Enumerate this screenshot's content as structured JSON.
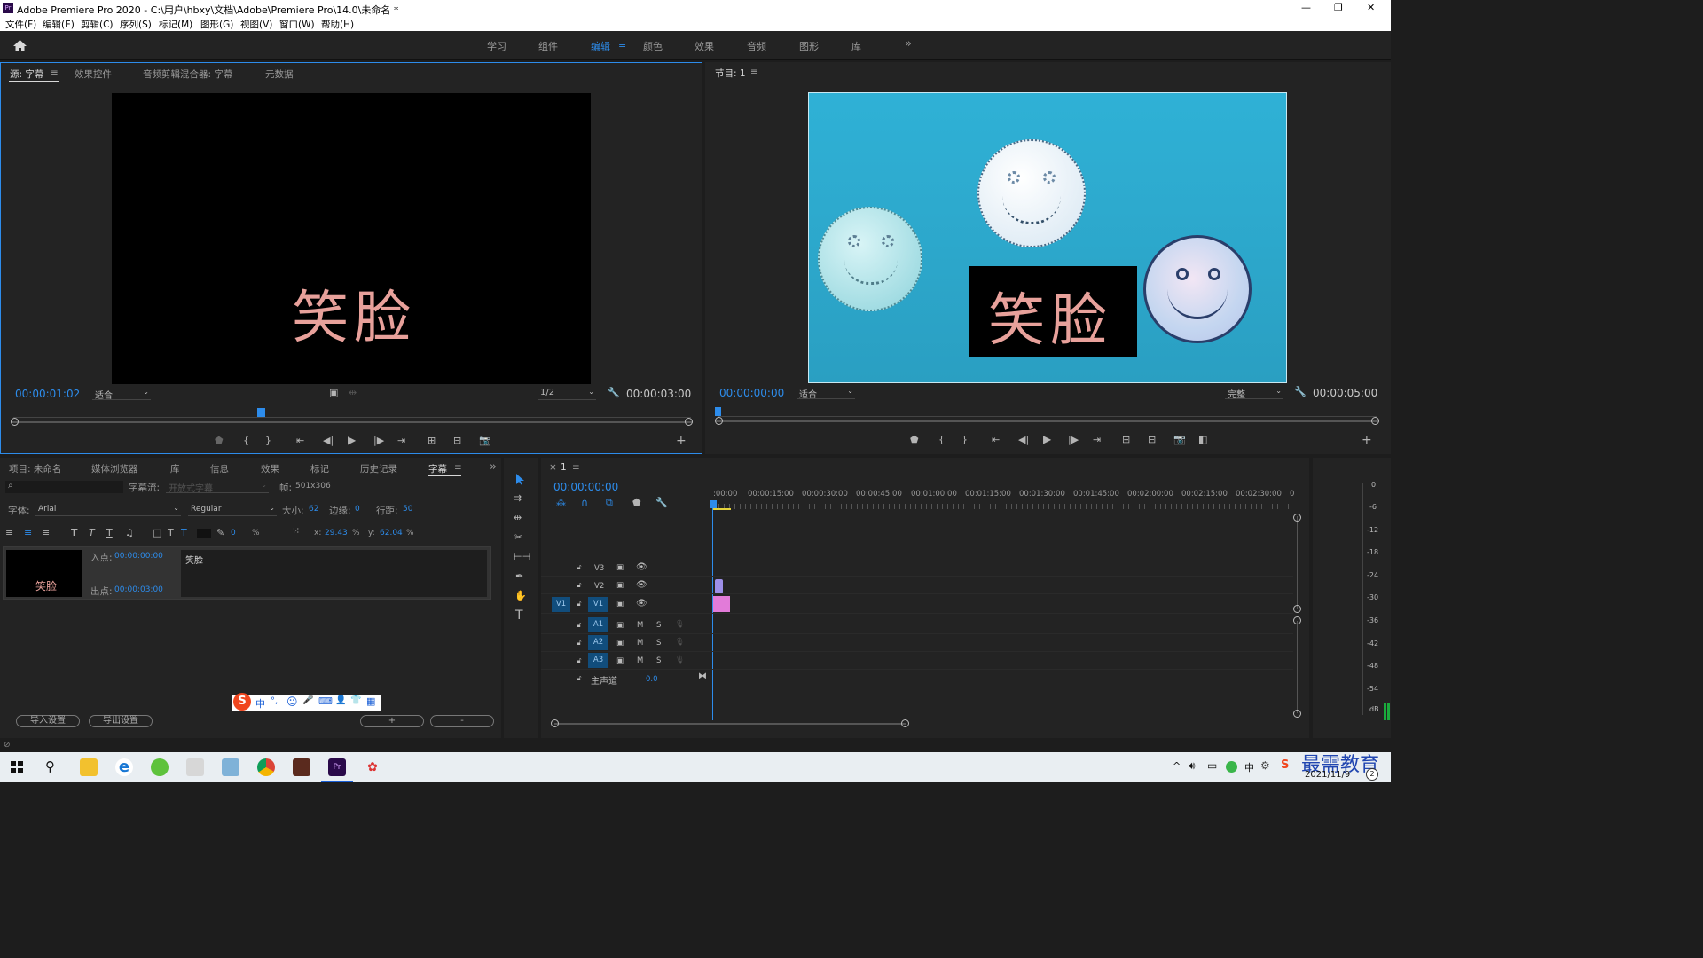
{
  "app": {
    "title": "Adobe Premiere Pro 2020 - C:\\用户\\hbxy\\文档\\Adobe\\Premiere Pro\\14.0\\未命名 *",
    "app_icon_label": "Pr"
  },
  "window_controls": {
    "minimize": "—",
    "maximize": "❐",
    "close": "✕"
  },
  "menu": [
    "文件(F)",
    "编辑(E)",
    "剪辑(C)",
    "序列(S)",
    "标记(M)",
    "图形(G)",
    "视图(V)",
    "窗口(W)",
    "帮助(H)"
  ],
  "workspaces": {
    "items": [
      "学习",
      "组件",
      "编辑",
      "颜色",
      "效果",
      "音频",
      "图形",
      "库"
    ],
    "active": "编辑",
    "more": "»"
  },
  "source_panel": {
    "tabs": [
      "源: 字幕",
      "效果控件",
      "音频剪辑混合器: 字幕",
      "元数据"
    ],
    "active_tab": "源: 字幕",
    "caption_text": "笑脸",
    "timecode": "00:00:01:02",
    "fit": "适合",
    "resolution": "1/2",
    "duration": "00:00:03:00"
  },
  "program_panel": {
    "title": "节目: 1",
    "caption_text": "笑脸",
    "timecode": "00:00:00:00",
    "fit": "适合",
    "quality": "完整",
    "duration": "00:00:05:00"
  },
  "colors": {
    "accent": "#2d8ceb",
    "program_bg": "#2fb1d6",
    "caption_pink": "#e8a19b",
    "clip_pink": "#e27bd9",
    "track_blue": "#114d7c"
  },
  "project_panel": {
    "tabs": [
      "项目: 未命名",
      "媒体浏览器",
      "库",
      "信息",
      "效果",
      "标记",
      "历史记录",
      "字幕"
    ],
    "active_tab": "字幕",
    "more": "»",
    "caption_stream_label": "字幕流:",
    "caption_stream_value": "开放式字幕",
    "frame_label": "帧:",
    "frame_value": "501x306",
    "font_label": "字体:",
    "font_value": "Arial",
    "style_value": "Regular",
    "size_label": "大小:",
    "size_value": "62",
    "edge_label": "边缘:",
    "edge_value": "0",
    "line_label": "行距:",
    "line_value": "50",
    "opacity_value": "0",
    "opacity_unit": "%",
    "x_label": "x:",
    "x_value": "29.43",
    "y_label": "y:",
    "y_value": "62.04",
    "pct": "%",
    "entry": {
      "thumb_text": "笑脸",
      "in_label": "入点:",
      "in_value": "00:00:00:00",
      "out_label": "出点:",
      "out_value": "00:00:03:00",
      "text": "笑脸"
    },
    "import_btn": "导入设置",
    "export_btn": "导出设置",
    "add_btn": "+",
    "remove_btn": "-"
  },
  "ime_toolbar": {
    "logo": "S",
    "items": [
      "中",
      "°,",
      "☺",
      "🎤",
      "⌨",
      "👤",
      "👕",
      "▦"
    ]
  },
  "timeline": {
    "sequence": "1",
    "timecode": "00:00:00:00",
    "ruler": [
      ":00:00",
      "00:00:15:00",
      "00:00:30:00",
      "00:00:45:00",
      "00:01:00:00",
      "00:01:15:00",
      "00:01:30:00",
      "00:01:45:00",
      "00:02:00:00",
      "00:02:15:00",
      "00:02:30:00",
      "0"
    ],
    "video_tracks": [
      "V3",
      "V2",
      "V1"
    ],
    "audio_tracks": [
      "A1",
      "A2",
      "A3"
    ],
    "source_patch": "V1",
    "mute": "M",
    "solo": "S",
    "master_label": "主声道",
    "master_value": "0.0"
  },
  "meter": {
    "ticks": [
      "0",
      "-6",
      "-12",
      "-18",
      "-24",
      "-30",
      "-36",
      "-42",
      "-48",
      "-54",
      "dB"
    ]
  },
  "watermark": "最需教育",
  "taskbar": {
    "date": "2021/11/9",
    "input_method": "中",
    "notification_count": "2"
  }
}
